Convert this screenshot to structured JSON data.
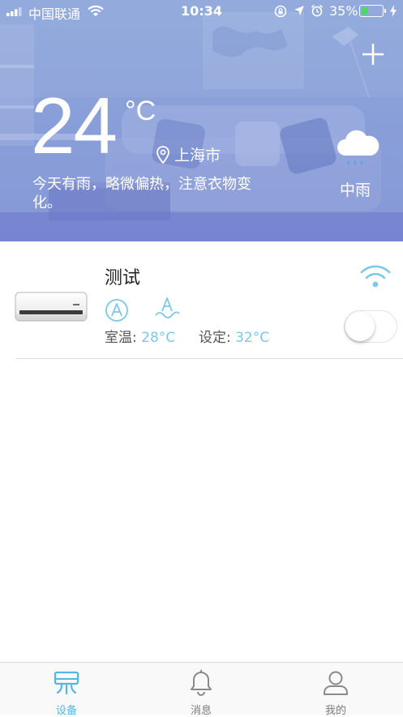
{
  "status_bar": {
    "carrier": "中国联通",
    "time": "10:34",
    "battery_percent": "35%",
    "battery_level": 0.35
  },
  "header": {
    "temperature": "24",
    "temperature_unit": "°C",
    "city": "上海市",
    "tip": "今天有雨，略微偏热，注意衣物变化。",
    "weather": "中雨",
    "icons": [
      "add-icon",
      "location-pin-icon",
      "rain-cloud-icon"
    ]
  },
  "device": {
    "name": "测试",
    "mode_icons": [
      "auto-mode-icon",
      "wave-mode-icon"
    ],
    "room_label": "室温:",
    "room_value": "28°C",
    "set_label": "设定:",
    "set_value": "32°C",
    "power_on": false,
    "connection_icon": "wifi-icon"
  },
  "tabbar": {
    "tabs": [
      {
        "label": "设备",
        "icon": "device-icon",
        "active": true
      },
      {
        "label": "消息",
        "icon": "bell-icon",
        "active": false
      },
      {
        "label": "我的",
        "icon": "user-icon",
        "active": false
      }
    ]
  },
  "colors": {
    "accent": "#53b7e4",
    "value_text": "#7ec8e8",
    "header_gradient_top": "#8fa6d6",
    "header_gradient_bottom": "#6a74cc",
    "battery_green": "#4cd964"
  }
}
